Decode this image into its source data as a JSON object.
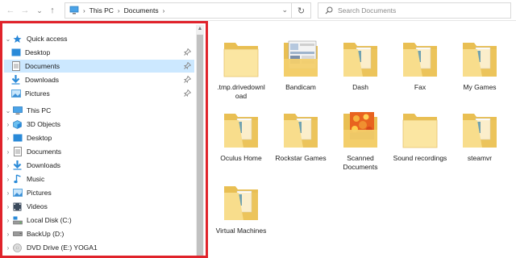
{
  "nav_buttons": {
    "back": "←",
    "forward": "→",
    "recent": "⌄",
    "up": "↑"
  },
  "address": {
    "crumbs": [
      "This PC",
      "Documents"
    ],
    "separator": "›",
    "dropdown": "⌄",
    "refresh": "↻"
  },
  "search": {
    "placeholder": "Search Documents"
  },
  "sidebar": {
    "scroll_up": "▲",
    "quick_access": {
      "label": "Quick access",
      "items": [
        {
          "label": "Desktop",
          "icon": "desktop-icon"
        },
        {
          "label": "Documents",
          "icon": "documents-icon"
        },
        {
          "label": "Downloads",
          "icon": "downloads-icon"
        },
        {
          "label": "Pictures",
          "icon": "pictures-icon"
        }
      ]
    },
    "this_pc": {
      "label": "This PC",
      "items": [
        {
          "label": "3D Objects",
          "icon": "3d-objects-icon"
        },
        {
          "label": "Desktop",
          "icon": "desktop-icon"
        },
        {
          "label": "Documents",
          "icon": "documents-icon"
        },
        {
          "label": "Downloads",
          "icon": "downloads-icon"
        },
        {
          "label": "Music",
          "icon": "music-icon"
        },
        {
          "label": "Pictures",
          "icon": "pictures-icon"
        },
        {
          "label": "Videos",
          "icon": "videos-icon"
        },
        {
          "label": "Local Disk (C:)",
          "icon": "local-disk-icon"
        },
        {
          "label": "BackUp (D:)",
          "icon": "drive-icon"
        },
        {
          "label": "DVD Drive (E:) YOGA1",
          "icon": "dvd-drive-icon"
        }
      ]
    },
    "selected": "Documents",
    "highlight_color": "#e0232b"
  },
  "folders": [
    {
      "name": ".tmp.drivedownload",
      "display": ".tmp.drivedownl oad",
      "thumb": "plain"
    },
    {
      "name": "Bandicam",
      "display": "Bandicam",
      "thumb": "screenshot"
    },
    {
      "name": "Dash",
      "display": "Dash",
      "thumb": "doc"
    },
    {
      "name": "Fax",
      "display": "Fax",
      "thumb": "doc"
    },
    {
      "name": "My Games",
      "display": "My Games",
      "thumb": "doc"
    },
    {
      "name": "Oculus Home",
      "display": "Oculus Home",
      "thumb": "doc"
    },
    {
      "name": "Rockstar Games",
      "display": "Rockstar Games",
      "thumb": "doc"
    },
    {
      "name": "Scanned Documents",
      "display": "Scanned Documents",
      "thumb": "photo"
    },
    {
      "name": "Sound recordings",
      "display": "Sound recordings",
      "thumb": "plain"
    },
    {
      "name": "steamvr",
      "display": "steamvr",
      "thumb": "doc"
    },
    {
      "name": "Virtual Machines",
      "display": "Virtual Machines",
      "thumb": "doc"
    }
  ],
  "colors": {
    "folder": "#f3cf6b",
    "folder_light": "#fbe6a2",
    "selected": "#cce8ff",
    "accent": "#0078d7"
  }
}
